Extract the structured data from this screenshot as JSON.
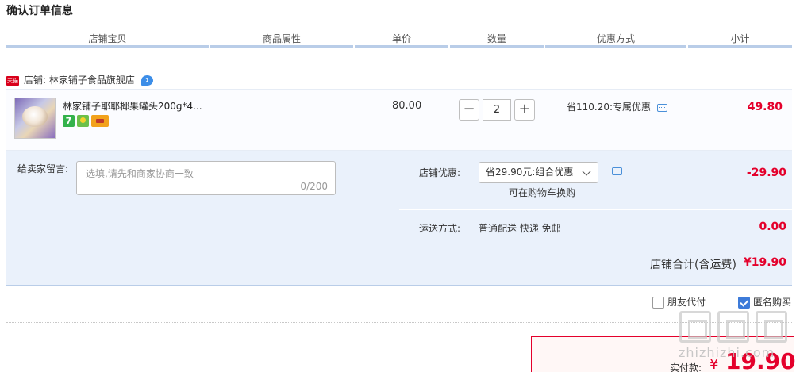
{
  "page": {
    "title": "确认订单信息"
  },
  "table_header": [
    "店铺宝贝",
    "商品属性",
    "单价",
    "数量",
    "优惠方式",
    "小计"
  ],
  "shop": {
    "badge": "天猫",
    "name": "店铺: 林家铺子食品旗舰店",
    "chat_badge": "1"
  },
  "item": {
    "name": "林家铺子耶耶椰果罐头200g*4...",
    "badges": [
      "7",
      "green-icon",
      "card-icon"
    ],
    "price": "80.00",
    "quantity": "2",
    "minus_label": "−",
    "plus_label": "+",
    "discount": "省110.20:专属优惠",
    "subtotal": "49.80"
  },
  "note": {
    "label": "给卖家留言:",
    "placeholder": "选填,请先和商家协商一致",
    "count": "0/200"
  },
  "shop_discount": {
    "label": "店铺优惠:",
    "selected": "省29.90元:组合优惠",
    "hint": "可在购物车换购",
    "amount": "-29.90"
  },
  "shipping": {
    "label": "运送方式:",
    "value": "普通配送 快递 免邮",
    "amount": "0.00"
  },
  "shop_total": {
    "label": "店铺合计(含运费)",
    "value": "¥19.90"
  },
  "options": {
    "friend_pay": "朋友代付",
    "anonymous": "匿名购买",
    "friend_pay_checked": false,
    "anonymous_checked": true
  },
  "payment": {
    "label": "实付款:",
    "currency": "¥",
    "value": "19.90"
  },
  "watermark": {
    "text": "zhizhizhi.com"
  },
  "colors": {
    "accent_red": "#e4002b",
    "panel_blue": "#eaf1fb",
    "header_line": "#b9cde8",
    "check_blue": "#3d7bd9"
  }
}
